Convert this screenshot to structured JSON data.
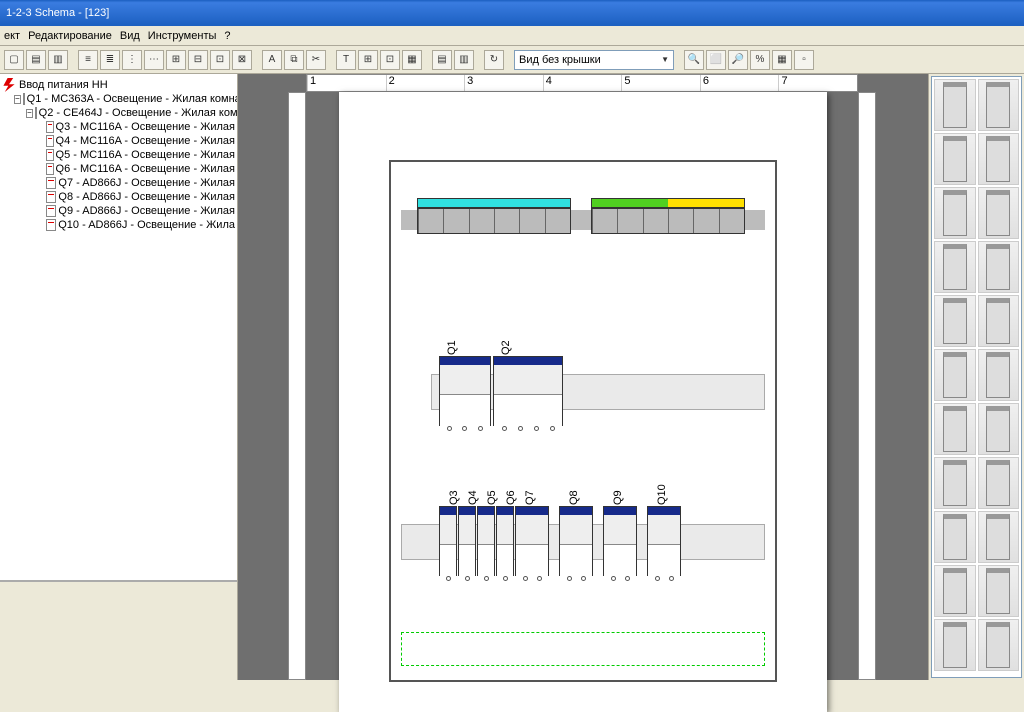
{
  "window": {
    "title": "1-2-3 Schema - [123]"
  },
  "menu": {
    "file": "ект",
    "edit": "Редактирование",
    "view": "Вид",
    "tools": "Инструменты",
    "help": "?"
  },
  "toolbar": {
    "view_select": "Вид без крышки"
  },
  "ruler": {
    "h": [
      "1",
      "2",
      "3",
      "4",
      "5",
      "6",
      "7"
    ]
  },
  "tree": {
    "root": "Ввод питания НН",
    "items": [
      {
        "id": "Q1",
        "label": "Q1 - MC363A - Освещение - Жилая комна"
      },
      {
        "id": "Q2",
        "label": "Q2 - CE464J - Освещение - Жилая ком"
      },
      {
        "id": "Q3",
        "label": "Q3 - MC116A - Освещение - Жилая"
      },
      {
        "id": "Q4",
        "label": "Q4 - MC116A - Освещение - Жилая"
      },
      {
        "id": "Q5",
        "label": "Q5 - MC116A - Освещение - Жилая"
      },
      {
        "id": "Q6",
        "label": "Q6 - MC116A - Освещение - Жилая"
      },
      {
        "id": "Q7",
        "label": "Q7 - AD866J - Освещение - Жилая"
      },
      {
        "id": "Q8",
        "label": "Q8 - AD866J - Освещение - Жилая"
      },
      {
        "id": "Q9",
        "label": "Q9 - AD866J - Освещение - Жилая"
      },
      {
        "id": "Q10",
        "label": "Q10 - AD866J - Освещение - Жила"
      }
    ]
  },
  "schematic": {
    "row2": [
      {
        "name": "Q1"
      },
      {
        "name": "Q2"
      }
    ],
    "row3": [
      {
        "name": "Q3"
      },
      {
        "name": "Q4"
      },
      {
        "name": "Q5"
      },
      {
        "name": "Q6"
      },
      {
        "name": "Q7"
      },
      {
        "name": "Q8"
      },
      {
        "name": "Q9"
      },
      {
        "name": "Q10"
      }
    ]
  }
}
